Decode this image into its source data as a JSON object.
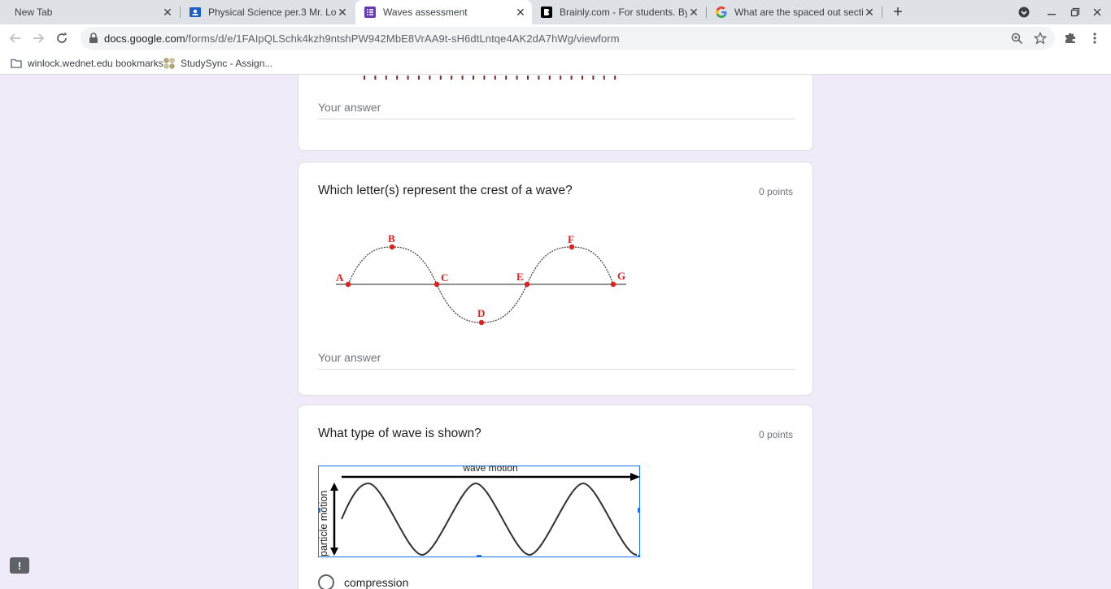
{
  "tabs": [
    {
      "title": "New Tab",
      "icon": "new-tab",
      "active": false
    },
    {
      "title": "Physical Science per.3 Mr. Locke",
      "icon": "classroom-icon",
      "active": false
    },
    {
      "title": "Waves assessment",
      "icon": "google-forms-icon",
      "active": true
    },
    {
      "title": "Brainly.com - For students. By st",
      "icon": "brainly-icon",
      "active": false
    },
    {
      "title": "What are the spaced out section",
      "icon": "google-icon",
      "active": false
    }
  ],
  "close_glyph": "✕",
  "new_tab_glyph": "+",
  "address": {
    "host": "docs.google.com",
    "path": "/forms/d/e/1FAIpQLSchk4kzh9ntshPW942MbE8VrAA9t-sH6dtLntqe4AK2dA7hWg/viewform"
  },
  "bookmarks": [
    {
      "label": "winlock.wednet.edu bookmarks",
      "icon": "folder-icon"
    },
    {
      "label": "StudySync - Assign...",
      "icon": "studysync-icon"
    }
  ],
  "form": {
    "answer_placeholder": "Your answer",
    "questions": [
      {
        "title": "Which letter(s) represent the crest of a wave?",
        "points": "0 points",
        "figure_labels": [
          "A",
          "B",
          "C",
          "D",
          "E",
          "F",
          "G"
        ]
      },
      {
        "title": "What type of wave is shown?",
        "points": "0 points",
        "figure_labels": {
          "top": "wave motion",
          "side": "particle motion"
        },
        "options": [
          "compression"
        ]
      }
    ]
  },
  "colors": {
    "background": "#f0ebf8",
    "figure_red": "#e0201e",
    "forms_purple": "#673ab7",
    "selection_blue": "#1a73e8"
  },
  "feedback_glyph": "!"
}
